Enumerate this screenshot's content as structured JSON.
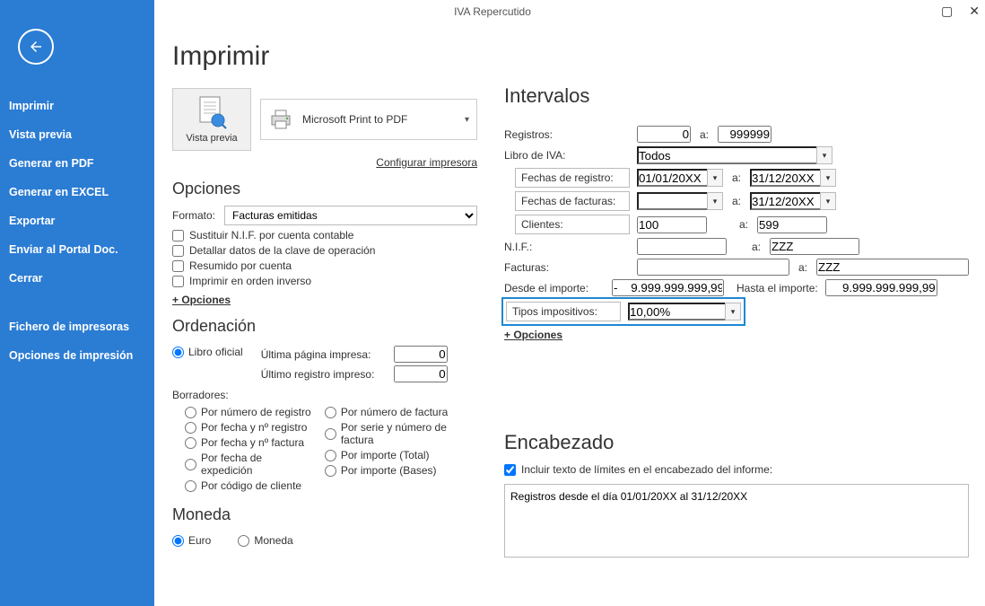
{
  "window": {
    "title": "IVA Repercutido"
  },
  "sidebar": {
    "items": [
      "Imprimir",
      "Vista previa",
      "Generar en PDF",
      "Generar en EXCEL",
      "Exportar",
      "Enviar al Portal Doc.",
      "Cerrar"
    ],
    "items2": [
      "Fichero de impresoras",
      "Opciones de impresión"
    ]
  },
  "page": {
    "title": "Imprimir",
    "preview_label": "Vista previa",
    "printer_name": "Microsoft Print to PDF",
    "config_printer": "Configurar impresora",
    "sections": {
      "opciones": "Opciones",
      "ordenacion": "Ordenación",
      "moneda": "Moneda",
      "intervalos": "Intervalos",
      "encabezado": "Encabezado"
    }
  },
  "opciones": {
    "formato_label": "Formato:",
    "formato_value": "Facturas emitidas",
    "checks": [
      "Sustituir N.I.F. por cuenta contable",
      "Detallar datos de la clave de operación",
      "Resumido por cuenta",
      "Imprimir en orden inverso"
    ],
    "more": "+ Opciones"
  },
  "ordenacion": {
    "libro_oficial": "Libro oficial",
    "ult_pag_label": "Última página impresa:",
    "ult_pag_val": "0",
    "ult_reg_label": "Último registro impreso:",
    "ult_reg_val": "0",
    "borradores_label": "Borradores:",
    "radios_col1": [
      "Por número de registro",
      "Por fecha y nº registro",
      "Por fecha y nº factura",
      "Por fecha de expedición",
      "Por código de cliente"
    ],
    "radios_col2": [
      "Por número de factura",
      "Por serie y número de factura",
      "Por importe (Total)",
      "Por importe (Bases)"
    ]
  },
  "moneda": {
    "euro": "Euro",
    "moneda": "Moneda"
  },
  "intervalos": {
    "registros_label": "Registros:",
    "registros_from": "0",
    "a": "a:",
    "registros_to": "999999",
    "libro_label": "Libro de IVA:",
    "libro_value": "Todos",
    "fechas_registro_label": "Fechas de registro:",
    "fechas_registro_from": "01/01/20XX",
    "fechas_registro_to": "31/12/20XX",
    "fechas_facturas_label": "Fechas de facturas:",
    "fechas_facturas_from": "",
    "fechas_facturas_to": "31/12/20XX",
    "clientes_label": "Clientes:",
    "clientes_from": "100",
    "clientes_to": "599",
    "nif_label": "N.I.F.:",
    "nif_from": "",
    "nif_to": "ZZZ",
    "facturas_label": "Facturas:",
    "facturas_from": "",
    "facturas_to": "ZZZ",
    "desde_importe_label": "Desde el importe:",
    "desde_importe_val": "-    9.999.999.999,99",
    "hasta_importe_label": "Hasta el importe:",
    "hasta_importe_val": "9.999.999.999,99",
    "tipos_label": "Tipos impositivos:",
    "tipos_val": "10,00%",
    "more": "+ Opciones"
  },
  "encabezado": {
    "check_label": "Incluir texto de límites en el encabezado del informe:",
    "text": "Registros desde el día 01/01/20XX al 31/12/20XX"
  }
}
